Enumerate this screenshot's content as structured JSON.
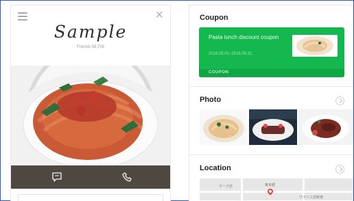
{
  "left": {
    "title": "Sample",
    "friends": "Friends 58,726"
  },
  "right": {
    "coupon": {
      "title": "Coupon",
      "text": "Pasta lunch discount coupon",
      "dates": "2016.05.01~2016.05.31",
      "footer": "COUPON"
    },
    "photo": {
      "title": "Photo"
    },
    "location": {
      "title": "Location",
      "labels": [
        "マーク店",
        "東京都",
        "ワタリエ店新宿"
      ]
    }
  },
  "colors": {
    "coupon_green": "#14b84f",
    "coupon_footer": "#0fa743",
    "action_bar": "#4f4841",
    "frame_blue": "#2d57c6"
  },
  "icons": {
    "menu": "hamburger-menu-icon",
    "close": "close-icon",
    "chat": "chat-icon",
    "phone": "phone-icon",
    "chevron": "chevron-right-icon",
    "pin": "map-pin-icon"
  }
}
